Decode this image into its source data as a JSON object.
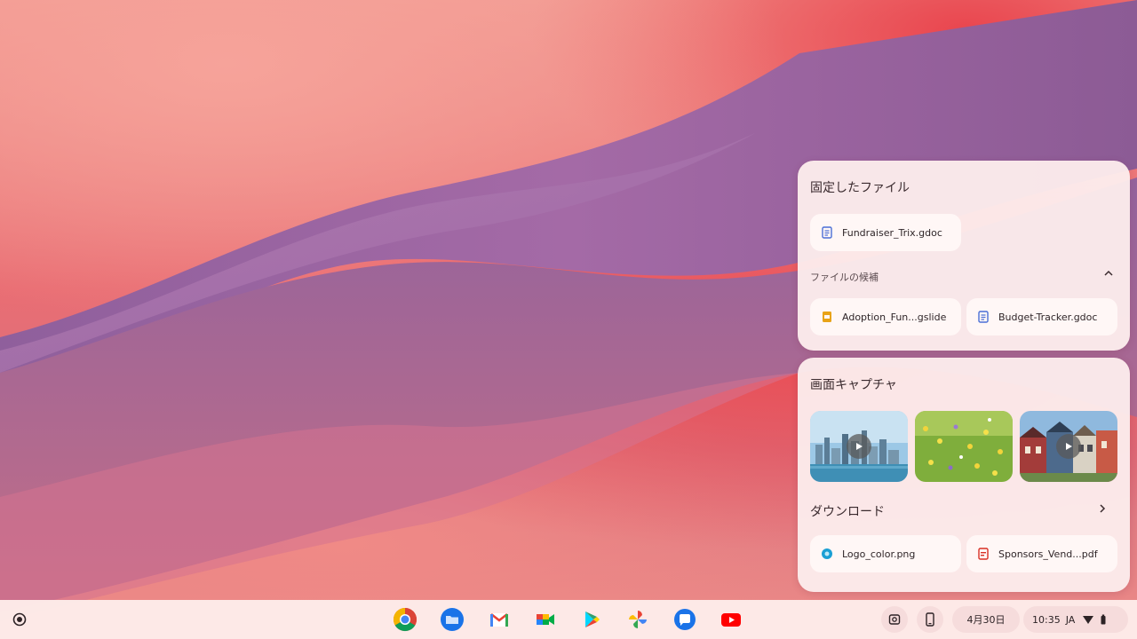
{
  "pinned_files": {
    "title": "固定したファイル",
    "files": [
      {
        "name": "Fundraiser_Trix.gdoc",
        "icon": "docs-icon"
      }
    ]
  },
  "suggested_files": {
    "title": "ファイルの候補",
    "files": [
      {
        "name": "Adoption_Fun...gslide",
        "icon": "slides-icon"
      },
      {
        "name": "Budget-Tracker.gdoc",
        "icon": "docs-icon"
      }
    ]
  },
  "screen_captures": {
    "title": "画面キャプチャ",
    "items": [
      {
        "kind": "video",
        "icon": "play-icon"
      },
      {
        "kind": "image"
      },
      {
        "kind": "video",
        "icon": "play-icon"
      }
    ]
  },
  "downloads": {
    "title": "ダウンロード",
    "files": [
      {
        "name": "Logo_color.png",
        "icon": "image-file-icon"
      },
      {
        "name": "Sponsors_Vend...pdf",
        "icon": "pdf-icon"
      }
    ]
  },
  "shelf": {
    "apps": [
      {
        "name": "Chrome",
        "icon": "chrome-icon"
      },
      {
        "name": "Files",
        "icon": "files-icon"
      },
      {
        "name": "Gmail",
        "icon": "gmail-icon"
      },
      {
        "name": "Meet",
        "icon": "meet-icon"
      },
      {
        "name": "Play Store",
        "icon": "play-store-icon"
      },
      {
        "name": "Photos",
        "icon": "photos-icon"
      },
      {
        "name": "Messages",
        "icon": "messages-icon"
      },
      {
        "name": "YouTube",
        "icon": "youtube-icon"
      }
    ],
    "date": "4月30日",
    "time": "10:35",
    "ime": "JA"
  },
  "colors": {
    "docs_blue": "#4a6fd6",
    "slides_yellow": "#e8a317",
    "pdf_red": "#d93025",
    "image_teal": "#1a9fd4"
  }
}
